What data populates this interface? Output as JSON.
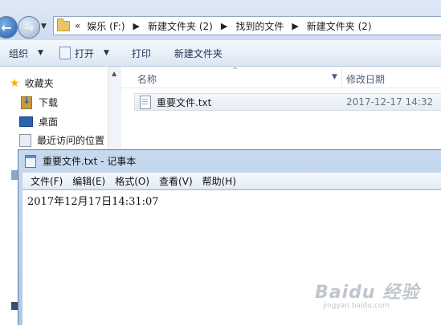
{
  "explorer": {
    "breadcrumb": {
      "overflow": "«",
      "segments": [
        "娱乐 (F:)",
        "新建文件夹 (2)",
        "找到的文件",
        "新建文件夹 (2)"
      ],
      "separator": "▶"
    },
    "toolbar": {
      "organize": "组织",
      "open": "打开",
      "print": "打印",
      "new_folder": "新建文件夹"
    },
    "nav_pane": {
      "favorites": "收藏夹",
      "items": [
        "下载",
        "桌面",
        "最近访问的位置"
      ]
    },
    "columns": {
      "name": "名称",
      "date_modified": "修改日期"
    },
    "files": [
      {
        "name": "重要文件.txt",
        "date": "2017-12-17 14:32"
      }
    ]
  },
  "notepad": {
    "title": "重要文件.txt - 记事本",
    "menu": [
      "文件(F)",
      "编辑(E)",
      "格式(O)",
      "查看(V)",
      "帮助(H)"
    ],
    "content": "2017年12月17日14:31:07"
  },
  "watermark": {
    "main": "Baidu 经验",
    "sub": "jingyan.baidu.com"
  },
  "icons": {
    "back": "back-arrow-icon",
    "forward": "forward-arrow-icon",
    "favorites": "star-icon",
    "file": "text-file-icon"
  }
}
